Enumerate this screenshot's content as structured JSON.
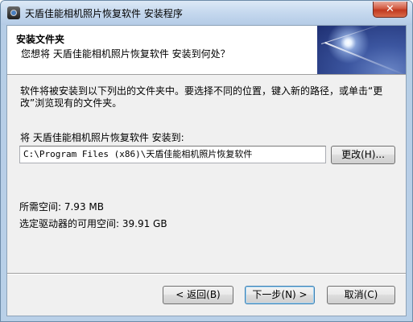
{
  "window": {
    "title": "天盾佳能相机照片恢复软件 安装程序",
    "close_label": "✕"
  },
  "header": {
    "title": "安装文件夹",
    "subtitle": "您想将 天盾佳能相机照片恢复软件 安装到何处？"
  },
  "body": {
    "description": "软件将被安装到以下列出的文件夹中。要选择不同的位置，键入新的路径，或单击“更改”浏览现有的文件夹。",
    "install_label": "将 天盾佳能相机照片恢复软件 安装到:",
    "install_path": "C:\\Program Files (x86)\\天盾佳能相机照片恢复软件",
    "change_button": "更改(H)...",
    "space_required": "所需空间: 7.93 MB",
    "space_available": "选定驱动器的可用空间: 39.91 GB"
  },
  "footer": {
    "back_button": "< 返回(B)",
    "next_button": "下一步(N) >",
    "cancel_button": "取消(C)"
  },
  "icons": {
    "app": "camera-recovery-app-icon",
    "close": "close-icon"
  },
  "colors": {
    "titlebar": "#c5d8ee",
    "close_button": "#c8412a",
    "dialog_bg": "#f0f0f0",
    "default_button_border": "#3c7fb1"
  }
}
